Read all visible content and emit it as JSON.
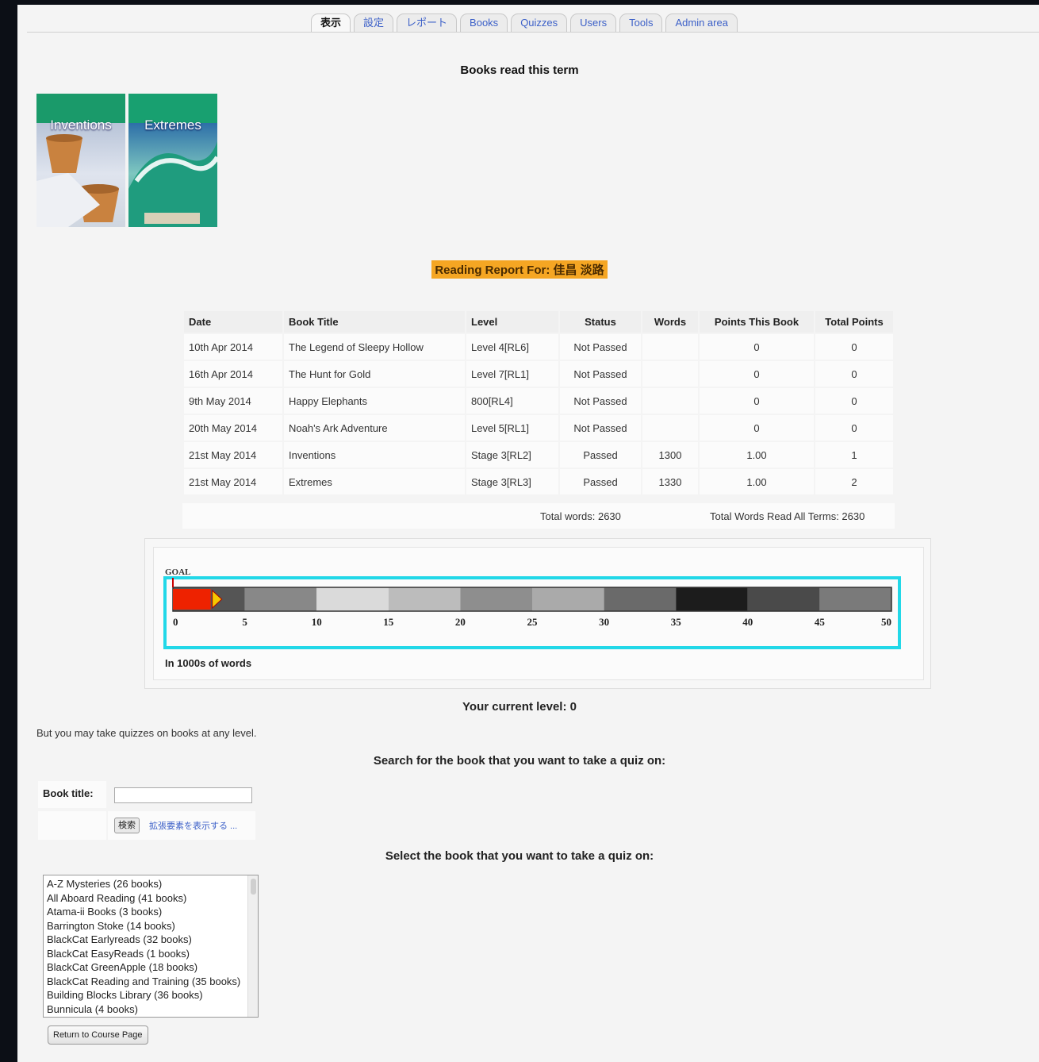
{
  "tabs": [
    "表示",
    "設定",
    "レポート",
    "Books",
    "Quizzes",
    "Users",
    "Tools",
    "Admin area"
  ],
  "books_read_title": "Books read this term",
  "covers": [
    {
      "label": "Inventions"
    },
    {
      "label": "Extremes"
    }
  ],
  "report_heading": "Reading Report For: 佳昌 淡路",
  "table": {
    "headers": [
      "Date",
      "Book Title",
      "Level",
      "Status",
      "Words",
      "Points This Book",
      "Total Points"
    ],
    "rows": [
      [
        "10th Apr 2014",
        "The Legend of Sleepy Hollow",
        "Level 4[RL6]",
        "Not Passed",
        "",
        "0",
        "0"
      ],
      [
        "16th Apr 2014",
        "The Hunt for Gold",
        "Level 7[RL1]",
        "Not Passed",
        "",
        "0",
        "0"
      ],
      [
        "9th May 2014",
        "Happy Elephants",
        "800[RL4]",
        "Not Passed",
        "",
        "0",
        "0"
      ],
      [
        "20th May 2014",
        "Noah's Ark Adventure",
        "Level 5[RL1]",
        "Not Passed",
        "",
        "0",
        "0"
      ],
      [
        "21st May 2014",
        "Inventions",
        "Stage 3[RL2]",
        "Passed",
        "1300",
        "1.00",
        "1"
      ],
      [
        "21st May 2014",
        "Extremes",
        "Stage 3[RL3]",
        "Passed",
        "1330",
        "1.00",
        "2"
      ]
    ]
  },
  "totals": {
    "total_words": "Total words: 2630",
    "total_all_terms": "Total Words Read All Terms: 2630"
  },
  "progress": {
    "goal_label": "GOAL",
    "ticks": [
      "0",
      "5",
      "10",
      "15",
      "20",
      "25",
      "30",
      "35",
      "40",
      "45",
      "50"
    ],
    "max": 50,
    "words_read_thousands": 2.63,
    "goal_thousands": 0,
    "unit_label": "In 1000s of words",
    "fill_color": "#ee2200",
    "border_color": "#22d8e8"
  },
  "current_level": "Your current level: 0",
  "note": "But you may take quizzes on books at any level.",
  "search_heading": "Search for the book that you want to take a quiz on:",
  "search": {
    "label": "Book title:",
    "button": "検索",
    "advanced_link": "拡張要素を表示する ...",
    "value": ""
  },
  "select_heading": "Select the book that you want to take a quiz on:",
  "series": [
    "A-Z Mysteries (26 books)",
    "All Aboard Reading (41 books)",
    "Atama-ii Books (3 books)",
    "Barrington Stoke (14 books)",
    "BlackCat Earlyreads (32 books)",
    "BlackCat EasyReads (1 books)",
    "BlackCat GreenApple (18 books)",
    "BlackCat Reading and Training (35 books)",
    "Building Blocks Library (36 books)",
    "Bunnicula (4 books)"
  ],
  "return_button": "Return to Course Page"
}
